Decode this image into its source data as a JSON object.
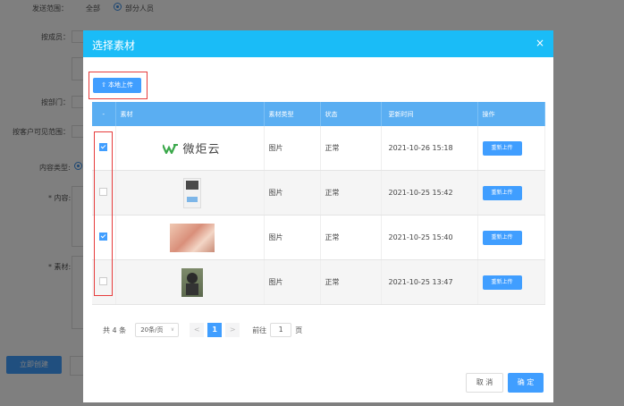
{
  "background": {
    "send_scope_label": "发送范围：",
    "send_scope_all": "全部",
    "send_scope_partial": "部分人员",
    "by_member_label": "按成员：",
    "by_dept_label": "按部门：",
    "customer_visible_label": "按客户可见范围：",
    "content_type_label": "内容类型:",
    "content_label": "* 内容:",
    "material_label": "* 素材:",
    "create_button": "立即创建"
  },
  "modal": {
    "title": "选择素材",
    "close_icon": "×",
    "upload_button": "本地上传",
    "upload_icon": "upload-arrow-icon",
    "columns": [
      "-",
      "素材",
      "素材类型",
      "状态",
      "更新时间",
      "操作"
    ],
    "rows": [
      {
        "checked": true,
        "thumb": "logo",
        "logo_text": "微炬云",
        "type": "图片",
        "status": "正常",
        "updated": "2021-10-26 15:18",
        "action": "重新上传"
      },
      {
        "checked": false,
        "thumb": "poster",
        "type": "图片",
        "status": "正常",
        "updated": "2021-10-25 15:42",
        "action": "重新上传"
      },
      {
        "checked": true,
        "thumb": "photo",
        "type": "图片",
        "status": "正常",
        "updated": "2021-10-25 15:40",
        "action": "重新上传"
      },
      {
        "checked": false,
        "thumb": "figure",
        "type": "图片",
        "status": "正常",
        "updated": "2021-10-25 13:47",
        "action": "重新上传"
      }
    ],
    "pagination": {
      "total": "共 4 条",
      "page_size": "20条/页",
      "prev": "<",
      "current_page": "1",
      "next": ">",
      "goto_label": "前往",
      "goto_value": "1",
      "page_suffix": "页"
    },
    "cancel_button": "取 消",
    "confirm_button": "确 定"
  },
  "colors": {
    "header": "#1abcf7",
    "primary": "#409eff",
    "status_ok": "#67c23a",
    "highlight": "#e63c3c"
  }
}
